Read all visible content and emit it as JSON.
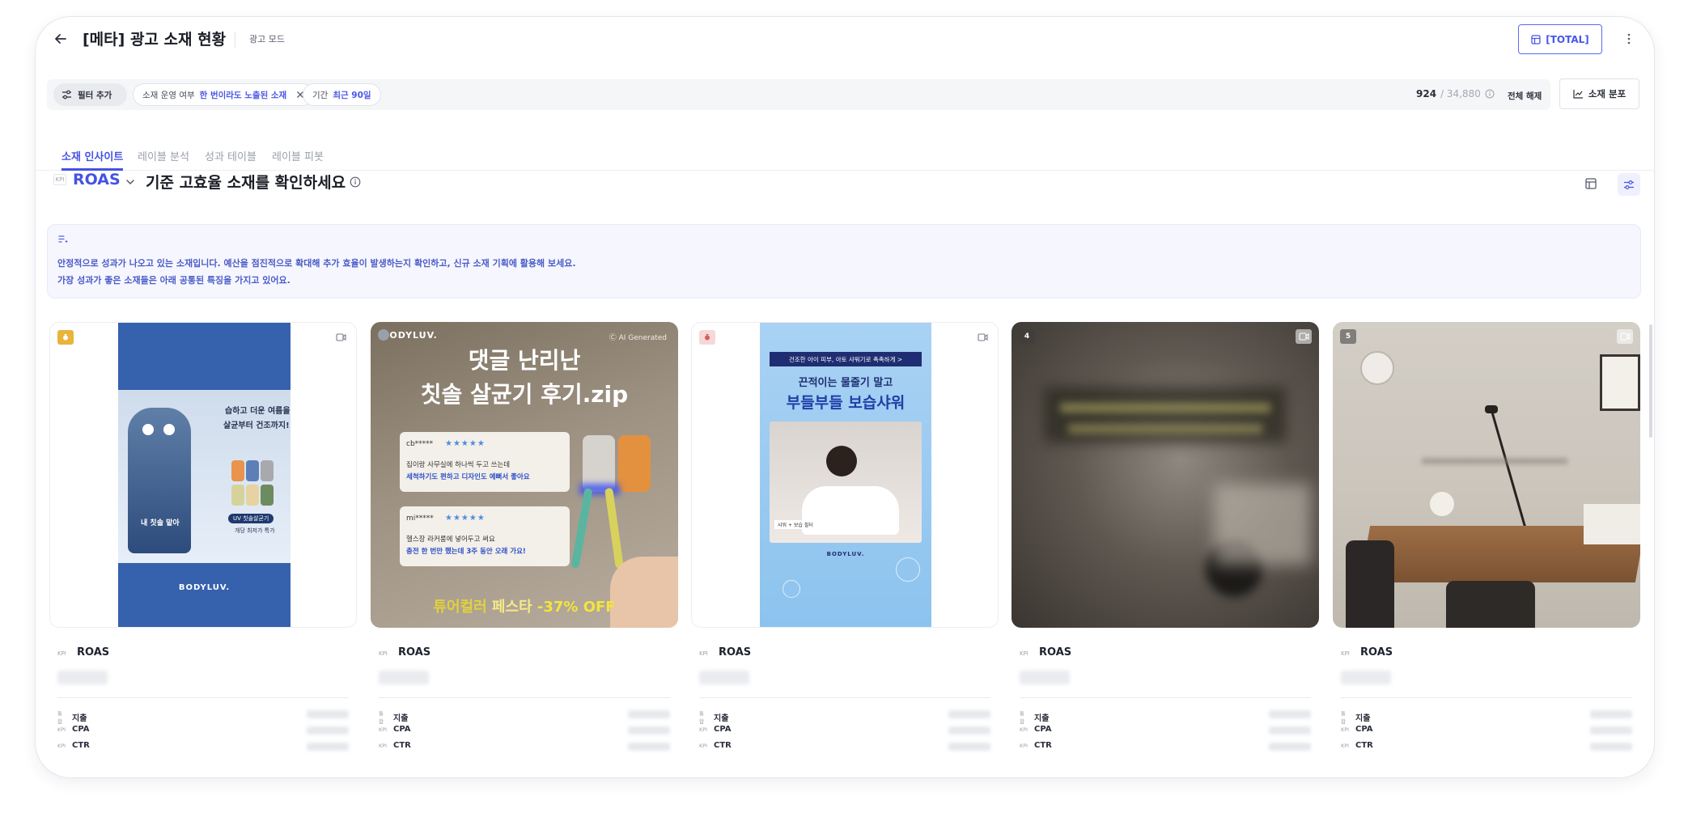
{
  "header": {
    "title": "[메타] 광고 소재 현황",
    "mode": "광고 모드",
    "total_button": "[TOTAL]"
  },
  "filters": {
    "add_label": "필터 추가",
    "chips": [
      {
        "label": "소재 운영 여부",
        "value": "한 번이라도 노출된 소재"
      },
      {
        "label": "기간",
        "value": "최근 90일"
      }
    ],
    "count": "924",
    "count_total": "/ 34,880",
    "reset_label": "전체 해제",
    "dist_button": "소재 분포"
  },
  "tabs": [
    {
      "label": "소재 인사이트",
      "active": true
    },
    {
      "label": "레이블 분석",
      "active": false
    },
    {
      "label": "성과 테이블",
      "active": false
    },
    {
      "label": "레이블 피봇",
      "active": false
    }
  ],
  "kpi": {
    "badge": "KPI",
    "name": "ROAS",
    "section_title": "기준 고효율 소재를 확인하세요"
  },
  "insight": {
    "line1": "안정적으로 성과가 나오고 있는 소재입니다. 예산을 점진적으로 확대해 추가 효율이 발생하는지 확인하고, 신규 소재 기획에 활용해 보세요.",
    "line2": "가장 성과가 좋은 소재들은 아래 공통된 특징을 가지고 있어요."
  },
  "cards": [
    {
      "rank": "1",
      "rank_color": "#e8b43c",
      "metric_badge": "KPI",
      "metric_name": "ROAS",
      "rows": [
        {
          "badge": "통합",
          "label": "지출"
        },
        {
          "badge": "KPI",
          "label": "CPA"
        },
        {
          "badge": "KPI",
          "label": "CTR"
        }
      ],
      "img": {
        "side_text_1": "습하고 더운 여름을",
        "side_text_2": "살균부터 건조까지!",
        "pill": "UV 칫솔살균기",
        "sub": "개당 최저가 특가",
        "mascot_text": "내 칫솔 맡아",
        "brand": "BODYLUV."
      }
    },
    {
      "rank": "2",
      "rank_color": "#9aa0aa",
      "metric_badge": "KPI",
      "metric_name": "ROAS",
      "rows": [
        {
          "badge": "통합",
          "label": "지출"
        },
        {
          "badge": "KPI",
          "label": "CPA"
        },
        {
          "badge": "KPI",
          "label": "CTR"
        }
      ],
      "img": {
        "brand": "BODYLUV.",
        "ai": "Ⓒ AI Generated",
        "headline_1": "댓글 난리난",
        "headline_2": "칫솔 살균기 후기.zip",
        "r1_user": "cb*****",
        "r1_stars": "★★★★★",
        "r1_l1": "집이랑 사무실에 하나씩 두고 쓰는데",
        "r1_l2": "세척하기도 편하고 디자인도 예뻐서 좋아요",
        "r2_user": "mi*****",
        "r2_stars": "★★★★★",
        "r2_l1": "헬스장 라커룸에 넣어두고 써요",
        "r2_l2": "충전 한 번만 했는데 3주 동안 오래 가요!",
        "promo_1": "튜어컬러",
        "promo_2": "페스타",
        "promo_3": "-37% OFF"
      }
    },
    {
      "rank": "3",
      "rank_color": "#e0595a",
      "metric_badge": "KPI",
      "metric_name": "ROAS",
      "rows": [
        {
          "badge": "통합",
          "label": "지출"
        },
        {
          "badge": "KPI",
          "label": "CPA"
        },
        {
          "badge": "KPI",
          "label": "CTR"
        }
      ],
      "img": {
        "bar": "건조한 아이 피부, 아토 샤워기로 촉촉하게 >",
        "l1": "끈적이는 물줄기 말고",
        "l2": "부들부들 보습샤워",
        "tag": "샤워 + 보습 필터",
        "brand": "BODYLUV."
      }
    },
    {
      "rank": "4",
      "rank_color": "rgba(60,60,60,0.55)",
      "metric_badge": "KPI",
      "metric_name": "ROAS",
      "rows": [
        {
          "badge": "통합",
          "label": "지출"
        },
        {
          "badge": "KPI",
          "label": "CPA"
        },
        {
          "badge": "KPI",
          "label": "CTR"
        }
      ],
      "img": {}
    },
    {
      "rank": "5",
      "rank_color": "rgba(60,60,60,0.55)",
      "metric_badge": "KPI",
      "metric_name": "ROAS",
      "rows": [
        {
          "badge": "통합",
          "label": "지출"
        },
        {
          "badge": "KPI",
          "label": "CPA"
        },
        {
          "badge": "KPI",
          "label": "CTR"
        }
      ],
      "img": {}
    }
  ]
}
